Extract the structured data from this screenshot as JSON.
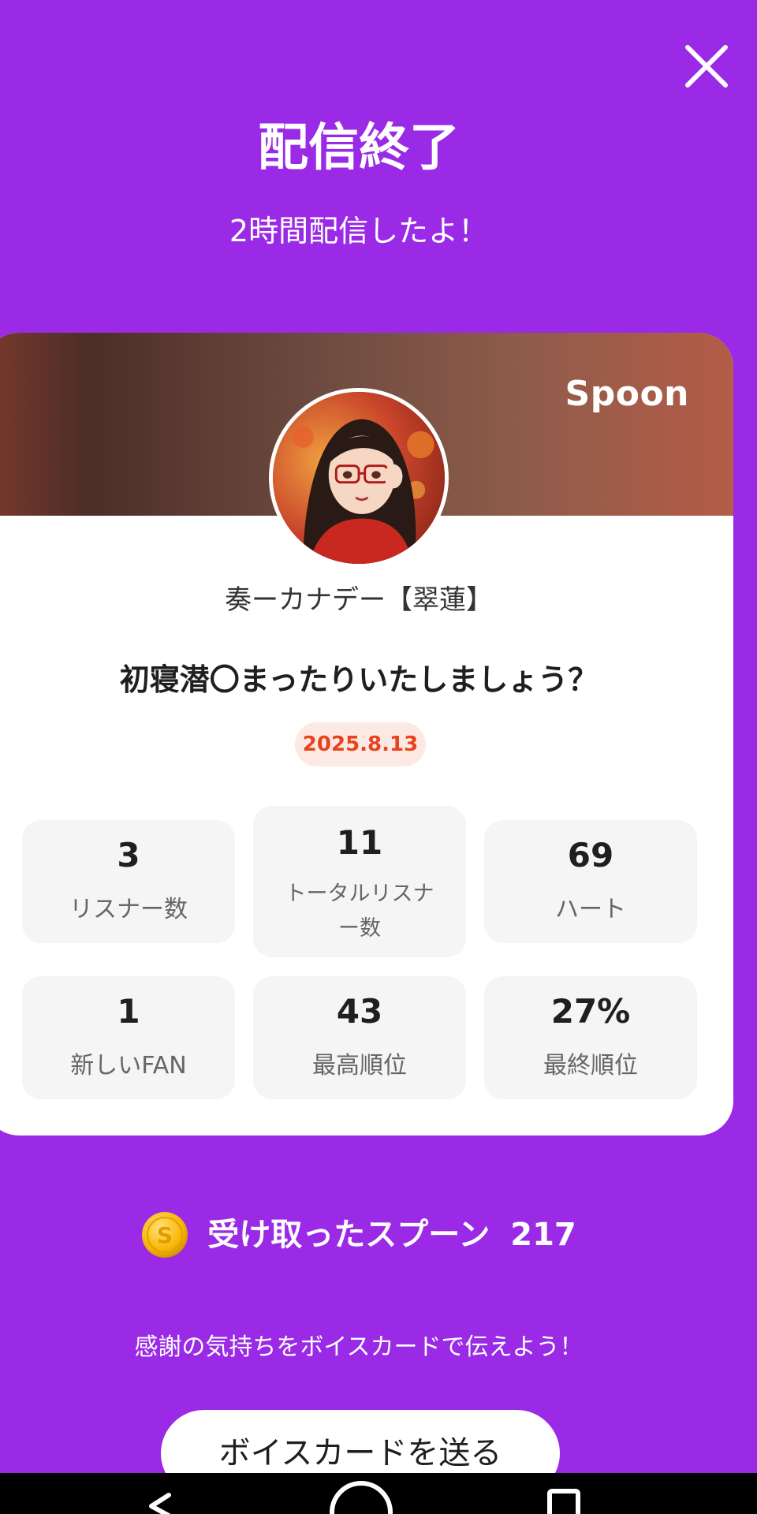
{
  "header": {
    "title": "配信終了",
    "subtitle": "2時間配信したよ！",
    "close_icon": "close-icon"
  },
  "card": {
    "brand": "Spoon",
    "streamer_name": "奏ーカナデー【翠蓮】",
    "stream_title": "初寝潜〇まったりいたしましょう？",
    "date": "2025.8.13",
    "stats": [
      {
        "value": "3",
        "label": "リスナー数"
      },
      {
        "value": "11",
        "label": "トータルリスナー数"
      },
      {
        "value": "69",
        "label": "ハート"
      },
      {
        "value": "1",
        "label": "新しいFAN"
      },
      {
        "value": "43",
        "label": "最高順位"
      },
      {
        "value": "27%",
        "label": "最終順位"
      }
    ]
  },
  "spoons": {
    "coin_letter": "S",
    "label": "受け取ったスプーン",
    "count": "217"
  },
  "thanks_text": "感謝の気持ちをボイスカードで伝えよう！",
  "voice_card_button": "ボイスカードを送る",
  "colors": {
    "background": "#9a2ae6",
    "date_accent": "#e8431c",
    "date_badge_bg": "#fde9e3",
    "stat_bg": "#f5f5f5",
    "coin": "#f7b500"
  }
}
